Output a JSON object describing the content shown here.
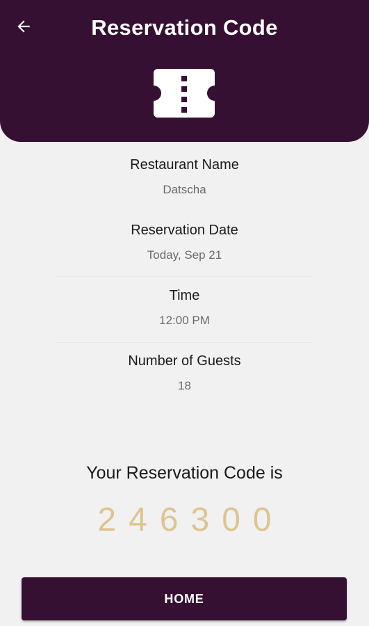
{
  "header": {
    "title": "Reservation Code",
    "back_icon": "arrow-left-icon",
    "ticket_icon": "ticket-icon"
  },
  "details": {
    "restaurant_label": "Restaurant Name",
    "restaurant_value": "Datscha",
    "date_label": "Reservation Date",
    "date_value": "Today, Sep 21",
    "time_label": "Time",
    "time_value": "12:00 PM",
    "guests_label": "Number of Guests",
    "guests_value": "18"
  },
  "code": {
    "title": "Your Reservation Code is",
    "value": "246300"
  },
  "footer": {
    "home_label": "HOME"
  },
  "colors": {
    "primary": "#361032",
    "code": "#dcc590",
    "background": "#f1f1f1"
  }
}
